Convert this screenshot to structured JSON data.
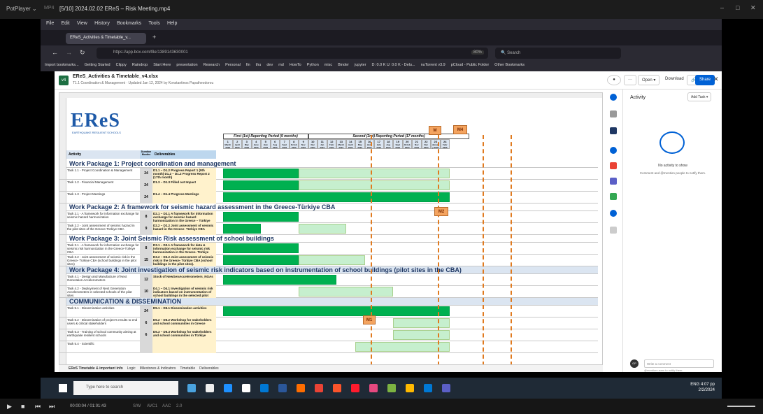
{
  "player": {
    "logo": "PotPlayer ⌄",
    "format": "MP4",
    "title": "[5/10] 2024.02.02 EReS – Risk Meeting.mp4",
    "time": "00:00:04 / 01:01:43",
    "tags": [
      "S/W",
      "AVC1",
      "AAC",
      "2.0"
    ]
  },
  "browser": {
    "menu": [
      "File",
      "Edit",
      "View",
      "History",
      "Bookmarks",
      "Tools",
      "Help"
    ],
    "tab_label": "EReS_Activities & Timetable_v...",
    "url": "https://app.box.com/file/1389143630001",
    "zoom": "80%",
    "search_placeholder": "Search",
    "bookmarks": [
      "Import bookmarks...",
      "Getting Started",
      "Clippy",
      "Raindrop",
      "Start Here",
      "presentation",
      "Research",
      "Personal",
      "fin",
      "thu",
      "dev",
      "md",
      "HowTo",
      "Python",
      "misc",
      "Binder",
      "jupyter",
      "D: 0.0 K U: 0.0 K - Delu...",
      "nuTorrent v3.9",
      "pCloud - Public Folder",
      "Other Bookmarks"
    ]
  },
  "box": {
    "file_name": "EReS_Activities & Timetable_v4.xlsx",
    "file_sub": "T1.1 Coordination & Management · Updated Jan 12, 2024 by Konstantinos Papatheodorou",
    "open_label": "Open",
    "download_label": "Download",
    "share_label": "Share",
    "activity_title": "Activity",
    "add_task": "Add Task",
    "no_activity": "No activity to show",
    "no_activity_hint": "Comment and @mention people to notify them.",
    "comment_placeholder": "Write a comment",
    "comment_hint": "@mention users to notify them."
  },
  "sheet": {
    "logo": "EReS",
    "logo_sub": "EARTHQUAKE RESILIENT SCHOOLS",
    "col_activity": "Activity",
    "col_duration": "Duration Months",
    "col_deliverables": "Deliverables",
    "period1": "First (1st) Reporting Period (9 months)",
    "period2": "Second (2nd) Reporting Period (17 months)",
    "month_nums": [
      "1",
      "2",
      "3",
      "4",
      "5",
      "6",
      "7",
      "8",
      "9",
      "10",
      "11",
      "12",
      "13",
      "14",
      "15",
      "16",
      "17",
      "18",
      "19",
      "20",
      "21",
      "22",
      "23",
      "24"
    ],
    "month_names": [
      "March 2023",
      "April 2023",
      "May 2023",
      "June 2023",
      "July 2023",
      "Aug 2023",
      "Sept 2023",
      "Octob 2023",
      "Nov 2023",
      "Dec 2024",
      "Jan 2024",
      "Febr 2024",
      "March 2024",
      "April 2024",
      "May 2024",
      "June 2024",
      "July 2024",
      "Aug 2024",
      "Sept 2024",
      "Octob 2024",
      "Nov 2024",
      "Dec 2024",
      "Januar y 2025",
      "Febr 2025"
    ],
    "milestones": [
      "M",
      "M4",
      "M2",
      "M1"
    ],
    "rows": [
      {
        "type": "wp",
        "text": "Work Package 1: Project coordination and management"
      },
      {
        "type": "task",
        "task": "Task 1.1 - Project Coordination & Management",
        "dur": "24",
        "deliv": "D1.1 – D1.2 Progress Report 1 (9th month) D1.2 – D1.2 Progress Report 2 (17th month)"
      },
      {
        "type": "task",
        "task": "Task 1.2 - Financial Management",
        "dur": "24",
        "deliv": "D1.3 – D1.3 Filled out Impact"
      },
      {
        "type": "task",
        "task": "Task 1.3 - Project Meetings",
        "dur": "24",
        "deliv": "D1.4 – D1.4 Progress Meetings"
      },
      {
        "type": "wp",
        "text": "Work Package 2: A framework for seismic hazard assessment in the Greece-Türkiye CBA"
      },
      {
        "type": "task",
        "task": "Task 2.1 - A framework for information exchange for seismic hazard harmonization",
        "dur": "8",
        "deliv": "D2.1 – D2.1 A framework for information exchange for seismic hazard harmonization in the Greece – Türkiye"
      },
      {
        "type": "task",
        "task": "Task 2.2 - Joint assessment of seismic hazard in the pilot sites of the Greece-Türkiye CBA",
        "dur": "9",
        "deliv": "D2.2 – D2.2 Joint assessment of seismic hazard in the Greece- Türkiye CBA"
      },
      {
        "type": "wp",
        "text": "Work Package 3: Joint Seismic Risk assessment of school buildings"
      },
      {
        "type": "task",
        "task": "Task 3.1 - A framework for information exchange for seismic risk harmonization in the Greece-Türkiye CBA",
        "dur": "8",
        "deliv": "D3.1 – D3.1 A framework for data & information exchange for seismic risk harmonization in the Greece- Türkiye CBA"
      },
      {
        "type": "task",
        "task": "Task 3.2 - Joint assessment of seismic risk in the Greece- Türkiye CBA (school buildings in the pilot sites)",
        "dur": "15",
        "deliv": "D3.2 – D3.2 Joint assessment of seismic risk in the Greece- Türkiye CBA (school buildings in the pilot sites)."
      },
      {
        "type": "wp",
        "text": "Work Package 4: Joint investigation of seismic risk indicators based on instrumentation of school buildings (pilot sites in the CBA)"
      },
      {
        "type": "task",
        "task": "Task 4.1 - Design and Manufacture of Next Generation Accelerometers",
        "dur": "12",
        "deliv": "Stock of NewGenAccelerometers_NGAs"
      },
      {
        "type": "task",
        "task": "Task 4.2 - Deployment of Next Generation Accelerometers in selected schools of the pilot sites",
        "dur": "10",
        "deliv": "D4.1 – D4.1 Investigation of seismic risk indicators based on instrumentation of school buildings in the selected pilot sites."
      },
      {
        "type": "wp",
        "text": "COMMUNICATION & DISSEMINATION"
      },
      {
        "type": "task",
        "task": "Task 5.1 - Dissemination activities",
        "dur": "24",
        "deliv": "D5.1 – D5.1 Dissemination activities"
      },
      {
        "type": "task",
        "task": "Task 5.2 - Dissemination of project's results to end users & critical stakeholders",
        "dur": "6",
        "deliv": "D5.2 – D5.2 Workshop for stakeholders and school communities in Greece"
      },
      {
        "type": "task",
        "task": "Task 5.3 - Training of school community aiming at earthquake resilient schools",
        "dur": "6",
        "deliv": "D5.3 – D5.3 Workshop for stakeholders and school communities in Türkiye"
      },
      {
        "type": "task",
        "task": "Task 5.4 - Scientific",
        "dur": "",
        "deliv": ""
      }
    ],
    "sheet_tabs": [
      "EReS Timetable & important info",
      "Logic",
      "Milestones & Indicators",
      "Timetable",
      "Deliverables"
    ]
  },
  "taskbar": {
    "search_placeholder": "Type here to search",
    "time": "4:07 pp",
    "date": "2/2/2024",
    "lang": "ENG"
  }
}
